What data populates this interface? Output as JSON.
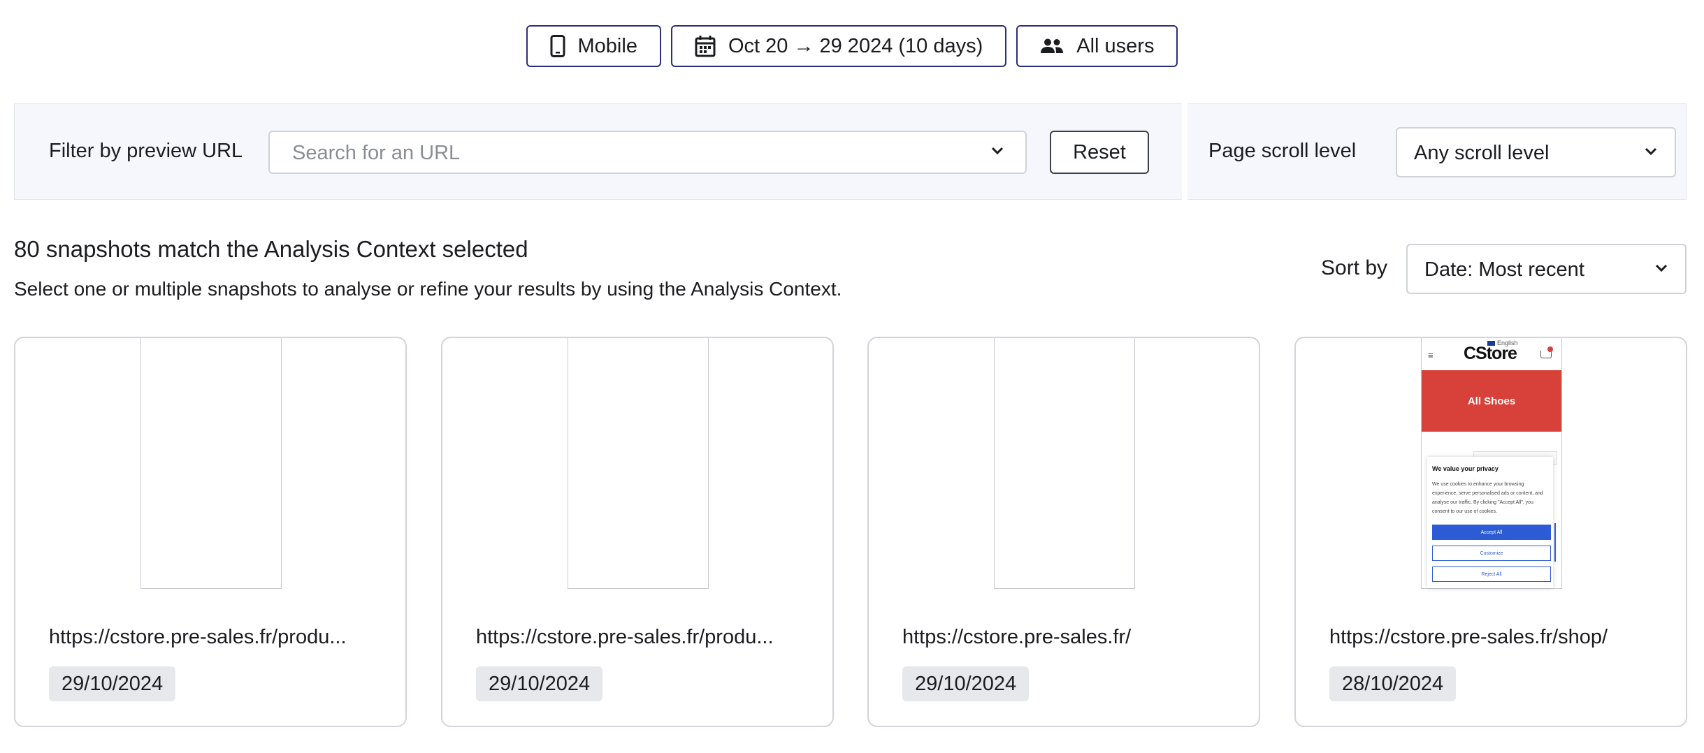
{
  "context_bar": {
    "device": {
      "label": "Mobile",
      "icon": "smartphone-icon"
    },
    "date_range": {
      "label": "Oct 20 → 29 2024 (10 days)",
      "icon": "calendar-icon"
    },
    "segment": {
      "label": "All users",
      "icon": "users-icon"
    }
  },
  "filters": {
    "url_label": "Filter by preview URL",
    "url_placeholder": "Search for an URL",
    "reset_label": "Reset",
    "scroll_label": "Page scroll level",
    "scroll_value": "Any scroll level"
  },
  "results": {
    "title": "80 snapshots match the Analysis Context selected",
    "subtitle": "Select one or multiple snapshots to analyse or refine your results by using the Analysis Context."
  },
  "sort": {
    "label": "Sort by",
    "value": "Date: Most recent"
  },
  "snapshots": [
    {
      "url": "https://cstore.pre-sales.fr/produ...",
      "date": "29/10/2024",
      "thumbnail": "blank"
    },
    {
      "url": "https://cstore.pre-sales.fr/produ...",
      "date": "29/10/2024",
      "thumbnail": "blank"
    },
    {
      "url": "https://cstore.pre-sales.fr/",
      "date": "29/10/2024",
      "thumbnail": "blank"
    },
    {
      "url": "https://cstore.pre-sales.fr/shop/",
      "date": "28/10/2024",
      "thumbnail": "cstore-shop"
    }
  ],
  "thumbnail_cstore": {
    "language": "English",
    "logo": "CStore",
    "hero_title": "All Shoes",
    "cookie_title": "We value your privacy",
    "cookie_text": "We use cookies to enhance your browsing experience, serve personalised ads or content, and analyse our traffic. By clicking \"Accept All\", you consent to our use of cookies.",
    "accept_label": "Accept All",
    "customize_label": "Customize",
    "reject_label": "Reject All"
  },
  "colors": {
    "chip_border": "#2b2f7a",
    "filter_background": "#f5f7fc",
    "date_badge": "#e7e8eb",
    "cstore_red": "#d8413a",
    "cstore_blue": "#2d5bd4"
  }
}
